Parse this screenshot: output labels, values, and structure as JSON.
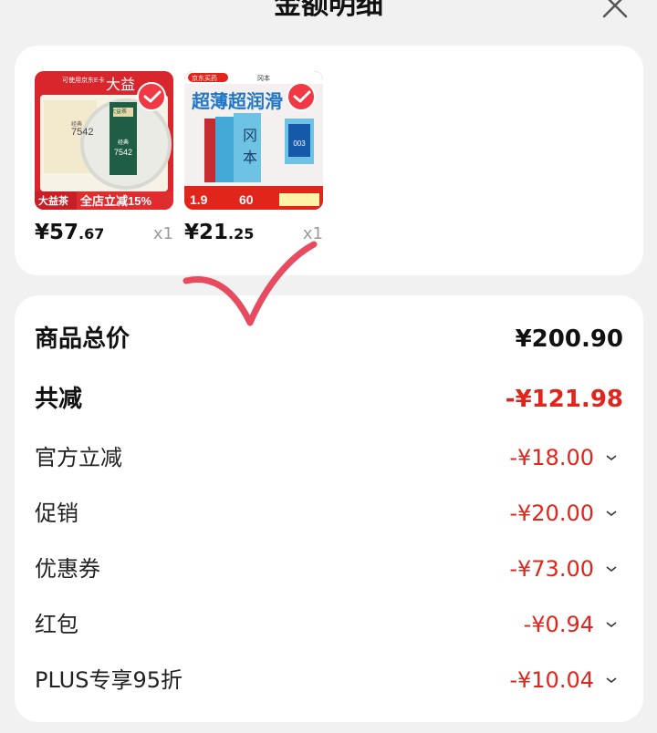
{
  "header": {
    "title": "金额明细"
  },
  "products": [
    {
      "price_int": "¥57",
      "price_dec": ".67",
      "qty": "x1",
      "image_text": {
        "banner": "可使用京东E卡",
        "brand": "大益",
        "brand_sub": "大益茶",
        "code": "7542",
        "label": "经典",
        "promo": "全店立减15%",
        "promo_brand": "大益茶"
      }
    },
    {
      "price_int": "¥21",
      "price_dec": ".25",
      "qty": "x1",
      "image_text": {
        "store": "京东买药",
        "brand": "冈本",
        "headline": "超薄超润滑",
        "big_char": "冈",
        "big_char2": "本",
        "p1": "1.9",
        "p2": "60",
        "tag": "003"
      }
    }
  ],
  "summary": {
    "total_label": "商品总价",
    "total_value": "¥200.90",
    "discount_label": "共减",
    "discount_value": "-¥121.98",
    "items": [
      {
        "label": "官方立减",
        "value": "-¥18.00"
      },
      {
        "label": "促销",
        "value": "-¥20.00"
      },
      {
        "label": "优惠券",
        "value": "-¥73.00"
      },
      {
        "label": "红包",
        "value": "-¥0.94"
      },
      {
        "label": "PLUS专享95折",
        "value": "-¥10.04"
      }
    ]
  },
  "colors": {
    "accent": "#e1251b",
    "check": "#f13845",
    "annotation": "#e84a5f"
  },
  "icons": {
    "close": "close-icon",
    "check": "check-icon",
    "chevron": "chevron-down-icon"
  }
}
